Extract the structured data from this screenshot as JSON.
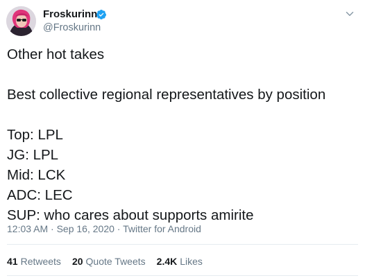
{
  "author": {
    "display_name": "Froskurinn",
    "handle": "@Froskurinn",
    "verified": true,
    "accent_color": "#1da1f2"
  },
  "tweet": {
    "lines": [
      "Other hot takes",
      "",
      "Best collective regional representatives by position",
      "",
      "Top: LPL",
      "JG: LPL",
      "Mid: LCK",
      "ADC: LEC",
      "SUP: who cares about supports amirite"
    ],
    "meta": "12:03 AM · Sep 16, 2020 · Twitter for Android"
  },
  "stats": {
    "retweets_count": "41",
    "retweets_label": "Retweets",
    "quotes_count": "20",
    "quotes_label": "Quote Tweets",
    "likes_count": "2.4K",
    "likes_label": "Likes"
  },
  "icons": {
    "verified": "verified-badge-icon",
    "menu": "chevron-down-icon"
  }
}
